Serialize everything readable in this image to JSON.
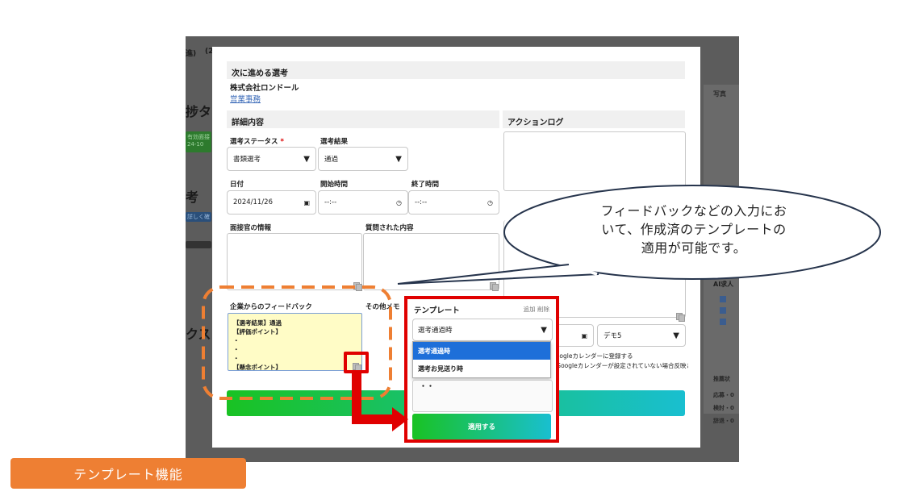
{
  "background": {
    "fragments": [
      "進)",
      "(2",
      "捗タ",
      "考",
      "クス",
      "写真",
      "AI求人",
      "推薦状",
      "応募・0",
      "検討・0",
      "辞退・0"
    ],
    "badge_text": "有効面接",
    "badge_date": "24-10",
    "badge_link": "詳しく確"
  },
  "modal": {
    "next_section_title": "次に進める選考",
    "company": "株式会社ロンドール",
    "job_link": "営業事務",
    "detail_section_title": "詳細内容",
    "action_log_title": "アクションログ",
    "status_label": "選考ステータス",
    "required_mark": "*",
    "status_value": "書類選考",
    "result_label": "選考結果",
    "result_value": "通過",
    "date_label": "日付",
    "date_value": "2024/11/26",
    "start_label": "開始時間",
    "start_value": "--:--",
    "end_label": "終了時間",
    "end_value": "--:--",
    "interviewer_label": "面接官の情報",
    "questions_label": "質問された内容",
    "feedback_label": "企業からのフィードバック",
    "feedback_lines": [
      "【選考結果】通過",
      "【評価ポイント】",
      "・",
      "・",
      "・",
      "【懸念ポイント】"
    ],
    "other_memo_label": "その他メモ",
    "demo_value": "デモ5",
    "calendar_register": "Googleカレンダーに登録する",
    "calendar_note": "※Googleカレンダーが設定されていない場合反映され"
  },
  "template_panel": {
    "title": "テンプレート",
    "add_label": "追加",
    "delete_label": "削除",
    "selected_value": "選考通過時",
    "options": [
      "選考通過時",
      "選考お見送り時"
    ],
    "preview_text": "・・",
    "apply_label": "適用する"
  },
  "callout": {
    "line1": "フィードバックなどの入力にお",
    "line2": "いて、作成済のテンプレートの",
    "line3": "適用が可能です。"
  },
  "caption": "テンプレート機能",
  "colors": {
    "accent_red": "#e00000",
    "accent_orange": "#ee7f33",
    "apply_gradient_start": "#19c223",
    "apply_gradient_end": "#19bfd0",
    "dropdown_selected": "#1e6fd9"
  }
}
